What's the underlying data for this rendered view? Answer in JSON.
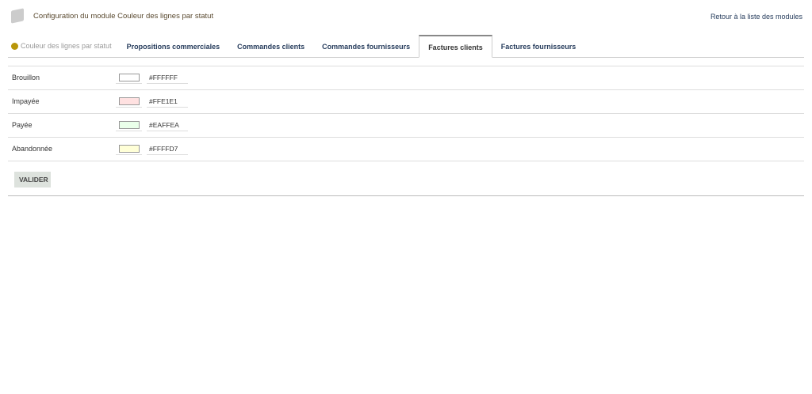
{
  "header": {
    "title": "Configuration du module Couleur des lignes par statut",
    "back_link": "Retour à la liste des modules"
  },
  "tabs": {
    "module": "Couleur des lignes par statut",
    "items": [
      "Propositions commerciales",
      "Commandes clients",
      "Commandes fournisseurs",
      "Factures clients",
      "Factures fournisseurs"
    ],
    "active": "Factures clients"
  },
  "statuses": [
    {
      "label": "Brouillon",
      "value": "#FFFFFF",
      "color": "#FFFFFF"
    },
    {
      "label": "Impayée",
      "value": "#FFE1E1",
      "color": "#FFE1E1"
    },
    {
      "label": "Payée",
      "value": "#EAFFEA",
      "color": "#EAFFEA"
    },
    {
      "label": "Abandonnée",
      "value": "#FFFFD7",
      "color": "#FFFFD7"
    }
  ],
  "submit_label": "VALIDER"
}
